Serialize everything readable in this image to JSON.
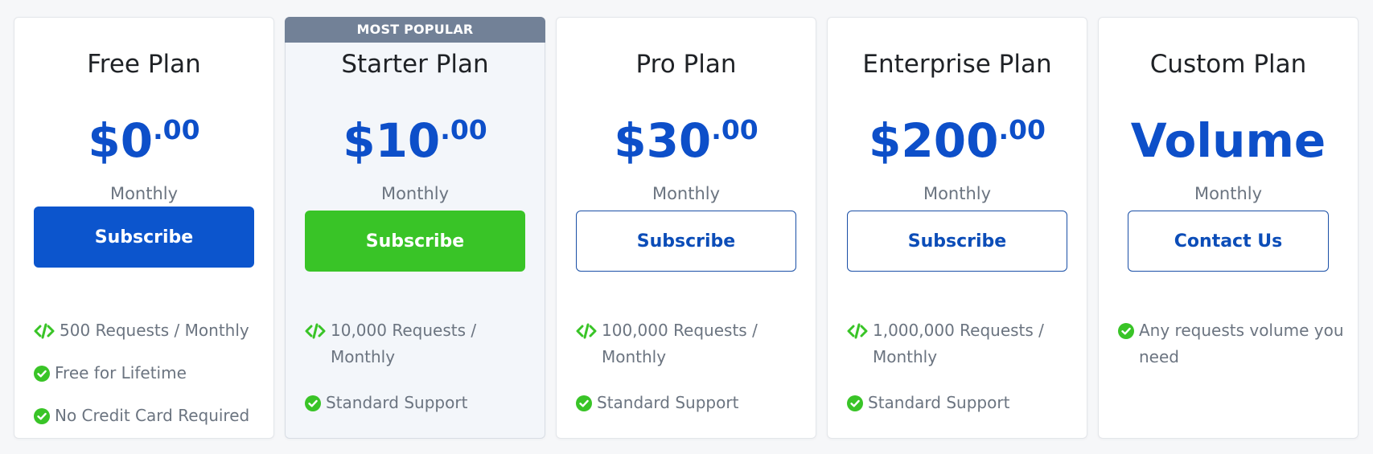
{
  "colors": {
    "accent_blue": "#0c55cd",
    "price_blue": "#0d4fc9",
    "green": "#39c427",
    "ribbon": "#728197",
    "muted_text": "#6b7480"
  },
  "plans": [
    {
      "name": "Free Plan",
      "price_main": "$0",
      "price_cents": ".00",
      "period": "Monthly",
      "button_label": "Subscribe",
      "features": [
        {
          "icon": "code-icon",
          "text": "500 Requests / Monthly"
        },
        {
          "icon": "check-circle-icon",
          "text": "Free for Lifetime"
        },
        {
          "icon": "check-circle-icon",
          "text": "No Credit Card Required"
        }
      ]
    },
    {
      "ribbon": "MOST POPULAR",
      "name": "Starter Plan",
      "price_main": "$10",
      "price_cents": ".00",
      "period": "Monthly",
      "button_label": "Subscribe",
      "features": [
        {
          "icon": "code-icon",
          "text": "10,000 Requests / Monthly"
        },
        {
          "icon": "check-circle-icon",
          "text": "Standard Support"
        }
      ]
    },
    {
      "name": "Pro Plan",
      "price_main": "$30",
      "price_cents": ".00",
      "period": "Monthly",
      "button_label": "Subscribe",
      "features": [
        {
          "icon": "code-icon",
          "text": "100,000 Requests / Monthly"
        },
        {
          "icon": "check-circle-icon",
          "text": "Standard Support"
        }
      ]
    },
    {
      "name": "Enterprise Plan",
      "price_main": "$200",
      "price_cents": ".00",
      "period": "Monthly",
      "button_label": "Subscribe",
      "features": [
        {
          "icon": "code-icon",
          "text": "1,000,000 Requests / Monthly"
        },
        {
          "icon": "check-circle-icon",
          "text": "Standard Support"
        }
      ]
    },
    {
      "name": "Custom Plan",
      "price_word": "Volume",
      "period": "Monthly",
      "button_label": "Contact Us",
      "features": [
        {
          "icon": "check-circle-icon",
          "text": "Any requests volume you need"
        }
      ]
    }
  ]
}
